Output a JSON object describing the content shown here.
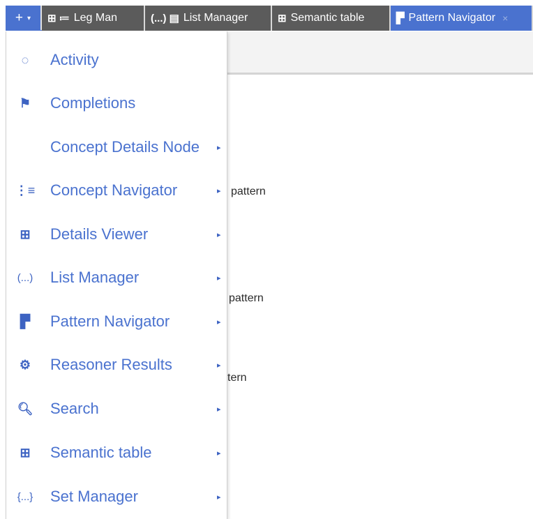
{
  "tabbar": {
    "add_label": "+",
    "add_caret": "▾",
    "tabs": [
      {
        "label": "Leg Man",
        "icons": "⊞ ≔",
        "active": false
      },
      {
        "label": "List Manager",
        "icons": "(...) ▤",
        "active": false
      },
      {
        "label": "Semantic table",
        "icons": "⊞",
        "active": false
      },
      {
        "label": "Pattern Navigator",
        "icons": "▛",
        "active": true,
        "close": "×"
      }
    ]
  },
  "background": {
    "texts": [
      "pattern",
      "pattern",
      "tern"
    ]
  },
  "menu": {
    "items": [
      {
        "label": "Activity",
        "icon_glyph": "◌",
        "icon": "activity-icon",
        "arrow": ""
      },
      {
        "label": "Completions",
        "icon_glyph": "⚑",
        "icon": "flag-icon",
        "arrow": ""
      },
      {
        "label": "Concept Details Node",
        "icon_glyph": "",
        "icon": "",
        "arrow": "▸"
      },
      {
        "label": "Concept Navigator",
        "icon_glyph": "⋮≡",
        "icon": "tree-icon",
        "arrow": "▸"
      },
      {
        "label": "Details Viewer",
        "icon_glyph": "⊞",
        "icon": "details-viewer-icon",
        "arrow": "▸"
      },
      {
        "label": "List Manager",
        "icon_glyph": "(...)",
        "icon": "list-icon",
        "arrow": "▸"
      },
      {
        "label": "Pattern Navigator",
        "icon_glyph": "▛",
        "icon": "pattern-icon",
        "arrow": "▸"
      },
      {
        "label": "Reasoner Results",
        "icon_glyph": "⚙",
        "icon": "gears-icon",
        "arrow": "▸"
      },
      {
        "label": "Search",
        "icon_glyph": "🔍︎",
        "icon": "search-icon",
        "arrow": "▸"
      },
      {
        "label": "Semantic table",
        "icon_glyph": "⊞",
        "icon": "table-icon",
        "arrow": "▸"
      },
      {
        "label": "Set Manager",
        "icon_glyph": "{...}",
        "icon": "set-icon",
        "arrow": "▸"
      }
    ]
  }
}
